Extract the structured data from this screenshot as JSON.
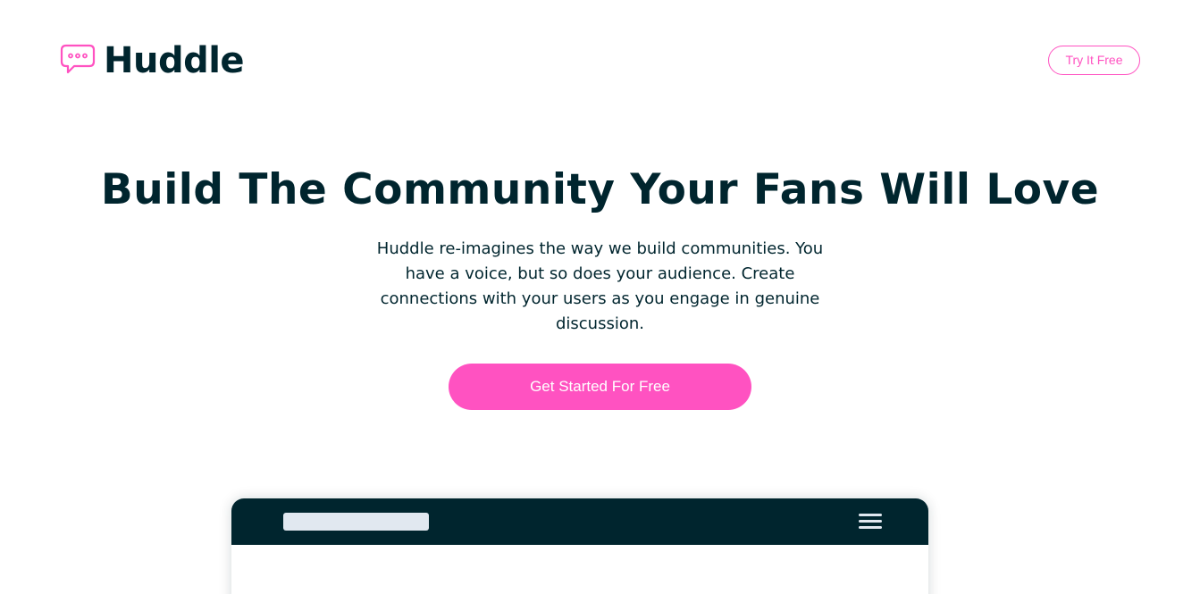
{
  "header": {
    "logo_text": "Huddle",
    "logo_icon": "chat-bubble-icon",
    "try_button_label": "Try It Free"
  },
  "hero": {
    "title": "Build The Community Your Fans Will Love",
    "description": "Huddle re-imagines the way we build communities. You have a voice, but so does your audience. Create connections with your users as you engage in genuine discussion.",
    "cta_label": "Get Started For Free"
  },
  "mockup": {
    "menu_icon": "hamburger-menu-icon"
  },
  "colors": {
    "accent": "#ff52c1",
    "dark": "#00252e",
    "light_bar": "#e1e8f0"
  }
}
